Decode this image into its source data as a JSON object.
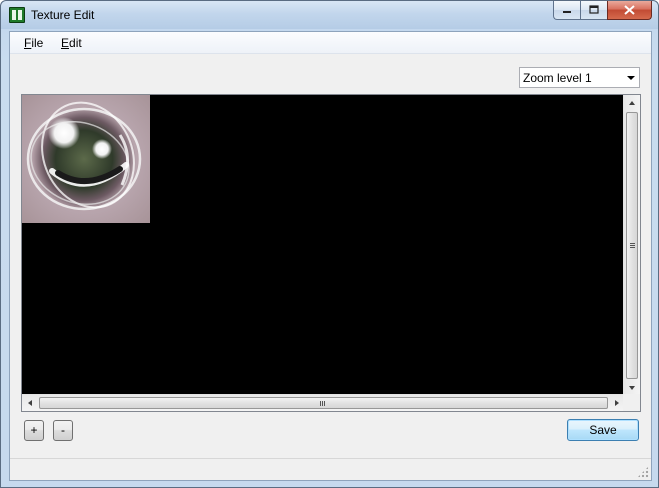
{
  "window": {
    "title": "Texture Edit",
    "icon": "texture-app-icon",
    "caption_buttons": [
      "minimize-icon",
      "maximize-icon",
      "close-icon"
    ]
  },
  "menu": {
    "items": [
      {
        "label": "File",
        "accel": "F",
        "rest": "ile"
      },
      {
        "label": "Edit",
        "accel": "E",
        "rest": "dit"
      }
    ]
  },
  "zoom": {
    "selected": "Zoom level 1"
  },
  "canvas": {
    "background": "#000000",
    "texture_description_icon": "smiley-orb-texture"
  },
  "buttons": {
    "zoom_in": "+",
    "zoom_out": "-",
    "save": "Save"
  },
  "colors": {
    "save_accent": "#3c7fb1",
    "close_button": "#c24b34"
  }
}
